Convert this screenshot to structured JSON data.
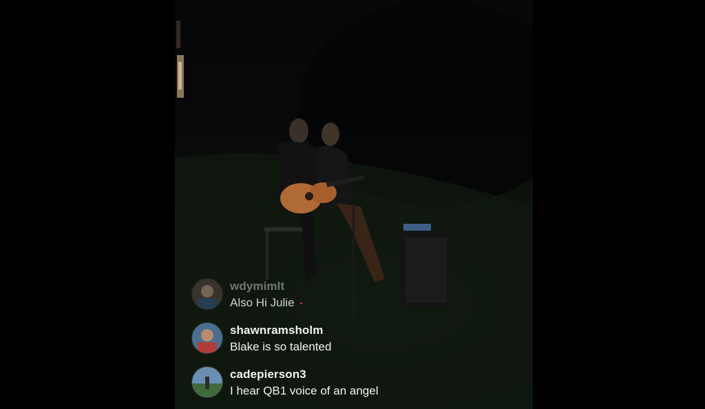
{
  "video": {
    "description_icon": "live-video-feed"
  },
  "comments": [
    {
      "username": "wdymimlt",
      "text": "Also Hi Julie",
      "avatar_icon": "user-avatar-icon"
    },
    {
      "username": "shawnramsholm",
      "text": "Blake is so talented",
      "avatar_icon": "user-avatar-icon"
    },
    {
      "username": "cadepierson3",
      "text": "I hear QB1 voice of an angel",
      "avatar_icon": "user-avatar-icon"
    }
  ],
  "colors": {
    "background": "#000000",
    "comment_text": "#f2f2f2",
    "heart": "#e2324a"
  }
}
